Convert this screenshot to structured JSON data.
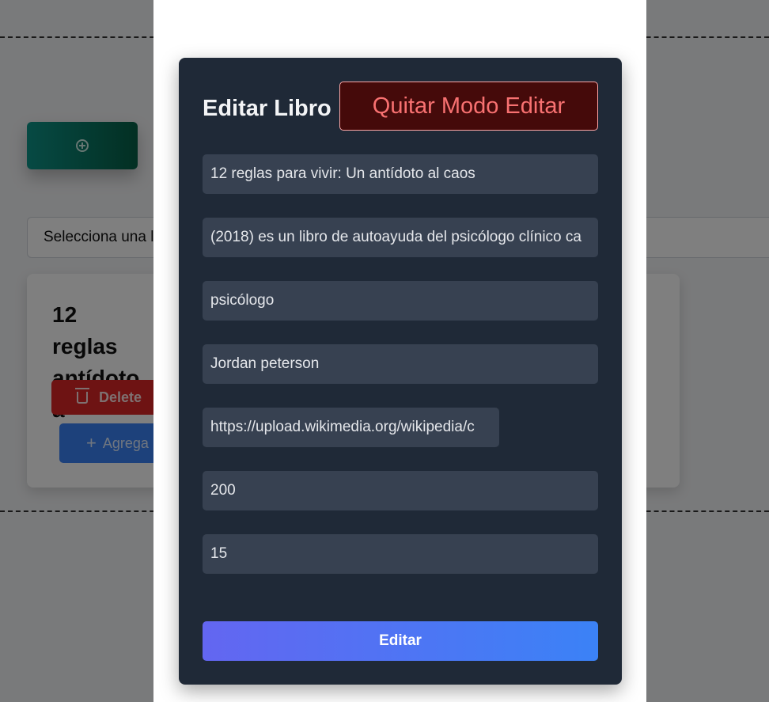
{
  "background": {
    "library_select_text": "Selecciona una l",
    "book_card": {
      "title": "12 reglas antídoto a",
      "delete_label": "Delete",
      "add_to_label": "Agrega"
    }
  },
  "edit_form": {
    "title": "Editar Libro",
    "exit_edit_label": "Quitar Modo Editar",
    "fields": {
      "title": "12 reglas para vivir: Un antídoto al caos",
      "description": "(2018) es un libro de autoayuda del psicólogo clínico ca",
      "category": "psicólogo",
      "author": "Jordan peterson",
      "image_url": "https://upload.wikimedia.org/wikipedia/c",
      "pages": "200",
      "price": "15"
    },
    "submit_label": "Editar"
  },
  "colors": {
    "card_bg": "#1f2937",
    "field_bg": "#374151",
    "exit_button_bg": "#450a0a",
    "exit_button_text": "#f87171",
    "submit_gradient_start": "#6366f1",
    "submit_gradient_end": "#3b82f6",
    "add_book_gradient_start": "#0d9488",
    "delete_button": "#dc2626",
    "add_to_button": "#3b82f6"
  },
  "icons": {
    "add_book": "plus-circle-icon",
    "delete": "trash-icon",
    "add_to": "plus-icon"
  }
}
